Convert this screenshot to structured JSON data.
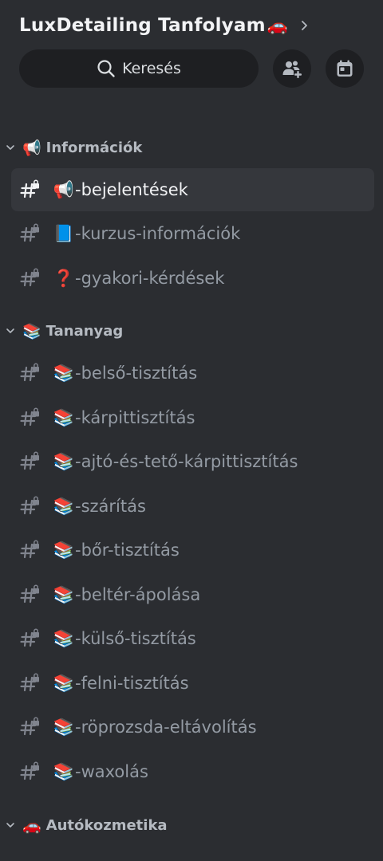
{
  "header": {
    "server_name": "LuxDetailing Tanfolyam",
    "server_emoji": "🚗",
    "chevron_icon": "chevron-right-icon"
  },
  "search": {
    "label": "Keresés",
    "icon": "search-icon"
  },
  "actions": [
    {
      "name": "invite-members-button",
      "icon": "add-member-icon"
    },
    {
      "name": "events-button",
      "icon": "calendar-icon"
    }
  ],
  "categories": [
    {
      "emoji": "📢",
      "label": "Információk",
      "collapsed": false,
      "channels": [
        {
          "emoji": "📢",
          "name": "-bejelentések",
          "active": true,
          "locked": true
        },
        {
          "emoji": "📘",
          "name": "-kurzus-információk",
          "active": false,
          "locked": true
        },
        {
          "emoji": "❓",
          "name": "-gyakori-kérdések",
          "active": false,
          "locked": true
        }
      ]
    },
    {
      "emoji": "📚",
      "label": "Tananyag",
      "collapsed": false,
      "channels": [
        {
          "emoji": "📚",
          "name": "-belső-tisztítás",
          "active": false,
          "locked": true
        },
        {
          "emoji": "📚",
          "name": "-kárpittisztítás",
          "active": false,
          "locked": true
        },
        {
          "emoji": "📚",
          "name": "-ajtó-és-tető-kárpittisztítás",
          "active": false,
          "locked": true
        },
        {
          "emoji": "📚",
          "name": "-szárítás",
          "active": false,
          "locked": true
        },
        {
          "emoji": "📚",
          "name": "-bőr-tisztítás",
          "active": false,
          "locked": true
        },
        {
          "emoji": "📚",
          "name": "-beltér-ápolása",
          "active": false,
          "locked": true
        },
        {
          "emoji": "📚",
          "name": "-külső-tisztítás",
          "active": false,
          "locked": true
        },
        {
          "emoji": "📚",
          "name": "-felni-tisztítás",
          "active": false,
          "locked": true
        },
        {
          "emoji": "📚",
          "name": "-röprozsda-eltávolítás",
          "active": false,
          "locked": true
        },
        {
          "emoji": "📚",
          "name": "-waxolás",
          "active": false,
          "locked": true
        }
      ]
    },
    {
      "emoji": "🚗",
      "label": "Autókozmetika",
      "collapsed": false,
      "channels": []
    }
  ],
  "colors": {
    "background": "#2b2d31",
    "input_background": "#1e1f22",
    "active_row": "#35373c",
    "text_primary": "#f2f3f5",
    "text_muted": "#949ba4",
    "category_text": "#b5bac1"
  }
}
